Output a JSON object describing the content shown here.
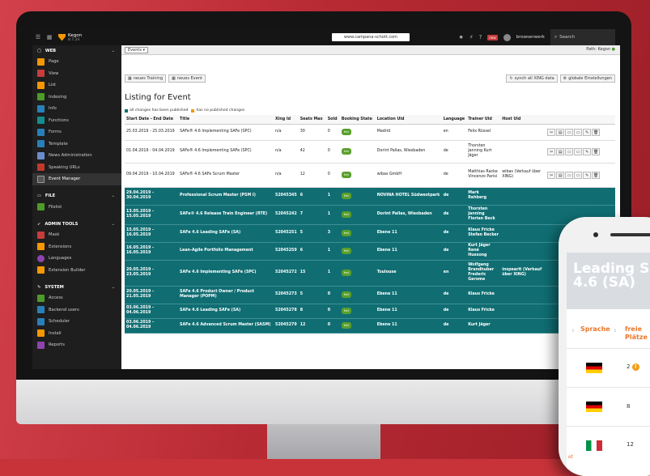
{
  "topbar": {
    "brand": "Kegon",
    "version": "8.7.24",
    "url": "www.campana-schott.com",
    "badge": "new",
    "user": "browserwerk",
    "search": "Search"
  },
  "sidebar": {
    "web": {
      "title": "WEB",
      "items": [
        "Page",
        "View",
        "List",
        "Indexing",
        "Info",
        "Functions",
        "Forms",
        "Template",
        "News Administration",
        "Speaking URLs",
        "Event Manager"
      ]
    },
    "file": {
      "title": "FILE",
      "items": [
        "Filelist"
      ]
    },
    "admin": {
      "title": "ADMIN TOOLS",
      "items": [
        "Mask",
        "Extensions",
        "Languages",
        "Extension Builder"
      ]
    },
    "system": {
      "title": "SYSTEM",
      "items": [
        "Access",
        "Backend users",
        "Scheduler",
        "Install",
        "Reports"
      ]
    }
  },
  "docheader": {
    "select": "Events",
    "path": "Path: Kegon"
  },
  "buttons": {
    "new_training": "neues Training",
    "new_event": "neues Event",
    "synch": "synch all XING data",
    "global": "globale Einstellungen"
  },
  "page_title": "Listing for Event",
  "legend": {
    "published": "all changes has been published",
    "unpublished": "has no published changes"
  },
  "table": {
    "headers": [
      "Start Date - End Date",
      "Title",
      "Xing Id",
      "Seats Max",
      "Sold",
      "Booking State",
      "Location Uid",
      "Language",
      "Trainer Uid",
      "Host Uid"
    ],
    "rows": [
      {
        "date": "25.03.2019 - 25.03.2019",
        "title": "SAFe® 4.6 Implementing SAFe (SPC)",
        "xing": "n/a",
        "seats": "30",
        "sold": "0",
        "state": "frei",
        "location": "Madrid",
        "lang": "en",
        "trainer": "Felix Rüssel",
        "host": "",
        "pub": true
      },
      {
        "date": "01.04.2019 - 04.04.2019",
        "title": "SAFe® 4.6 Implementing SAFe (SPC)",
        "xing": "n/a",
        "seats": "42",
        "sold": "0",
        "state": "frei",
        "location": "Dorint Pallas, Wiesbaden",
        "lang": "de",
        "trainer": "Thorsten Janning Kurt Jäger",
        "host": "",
        "pub": true
      },
      {
        "date": "09.04.2019 - 10.04.2019",
        "title": "SAFe® 4.6 SAFe Scrum Master",
        "xing": "n/a",
        "seats": "12",
        "sold": "0",
        "state": "frei",
        "location": "wibas GmbH",
        "lang": "de",
        "trainer": "Matthias Racke Vincenzo Parisi",
        "host": "wibas (Verkauf über XING)",
        "pub": true
      },
      {
        "date": "29.04.2019 - 30.04.2019",
        "title": "Professional Scrum Master (PSM I)",
        "xing": "52045345",
        "seats": "6",
        "sold": "1",
        "state": "frei",
        "location": "NOVINA HOTEL Südwestpark",
        "lang": "de",
        "trainer": "Mark Rehberg",
        "host": "",
        "pub": false
      },
      {
        "date": "13.05.2019 - 15.05.2019",
        "title": "SAFe® 4.6 Release Train Engineer (RTE)",
        "xing": "52045242",
        "seats": "7",
        "sold": "1",
        "state": "frei",
        "location": "Dorint Pallas, Wiesbaden",
        "lang": "de",
        "trainer": "Thorsten Janning Florian Beck",
        "host": "",
        "pub": false
      },
      {
        "date": "15.05.2019 - 16.05.2019",
        "title": "SAFe 4.6 Leading SAFe (SA)",
        "xing": "52045251",
        "seats": "5",
        "sold": "3",
        "state": "frei",
        "location": "Ebene 11",
        "lang": "de",
        "trainer": "Klaus Fricke Stefan Becker",
        "host": "",
        "pub": false
      },
      {
        "date": "16.05.2019 - 16.05.2019",
        "title": "Lean-Agile Portfolio Management",
        "xing": "52045259",
        "seats": "6",
        "sold": "1",
        "state": "frei",
        "location": "Ebene 11",
        "lang": "de",
        "trainer": "Kurt Jäger René Hussong",
        "host": "",
        "pub": false
      },
      {
        "date": "20.05.2019 - 23.05.2019",
        "title": "SAFe 4.6 Implementing SAFe (SPC)",
        "xing": "52045272",
        "seats": "15",
        "sold": "1",
        "state": "frei",
        "location": "Toulouse",
        "lang": "en",
        "trainer": "Wolfgang Brandhuber Frederic Gerome",
        "host": "inspearit (Verkauf über XING)",
        "pub": false
      },
      {
        "date": "20.05.2019 - 21.05.2019",
        "title": "SAFe 4.6 Product Owner / Product Manager (POPM)",
        "xing": "52045273",
        "seats": "5",
        "sold": "0",
        "state": "frei",
        "location": "Ebene 11",
        "lang": "de",
        "trainer": "Klaus Fricke",
        "host": "",
        "pub": false
      },
      {
        "date": "03.06.2019 - 04.06.2019",
        "title": "SAFe 4.6 Leading SAFe (SA)",
        "xing": "52045278",
        "seats": "8",
        "sold": "0",
        "state": "frei",
        "location": "Ebene 11",
        "lang": "de",
        "trainer": "Klaus Fricke",
        "host": "",
        "pub": false
      },
      {
        "date": "03.06.2019 - 04.06.2019",
        "title": "SAFe 4.6 Advanced Scrum Master (SASM)",
        "xing": "52045279",
        "seats": "12",
        "sold": "0",
        "state": "frei",
        "location": "Ebene 11",
        "lang": "de",
        "trainer": "Kurt Jäger",
        "host": "",
        "pub": false
      }
    ]
  },
  "phone": {
    "hero_title": "Leading S\n4.6 (SA)",
    "col_lang": "Sprache",
    "col_free": "freie Plätze",
    "rows": [
      {
        "value": "2",
        "warn": true
      },
      {
        "value": "8",
        "warn": false
      },
      {
        "value": "12",
        "warn": false
      }
    ],
    "footer_fragment": "et"
  },
  "colors": {
    "published": "#106e73",
    "unpublished": "#f49700",
    "accent": "#f49700",
    "frei": "#5aa02c",
    "phone_header": "#e8772b"
  }
}
